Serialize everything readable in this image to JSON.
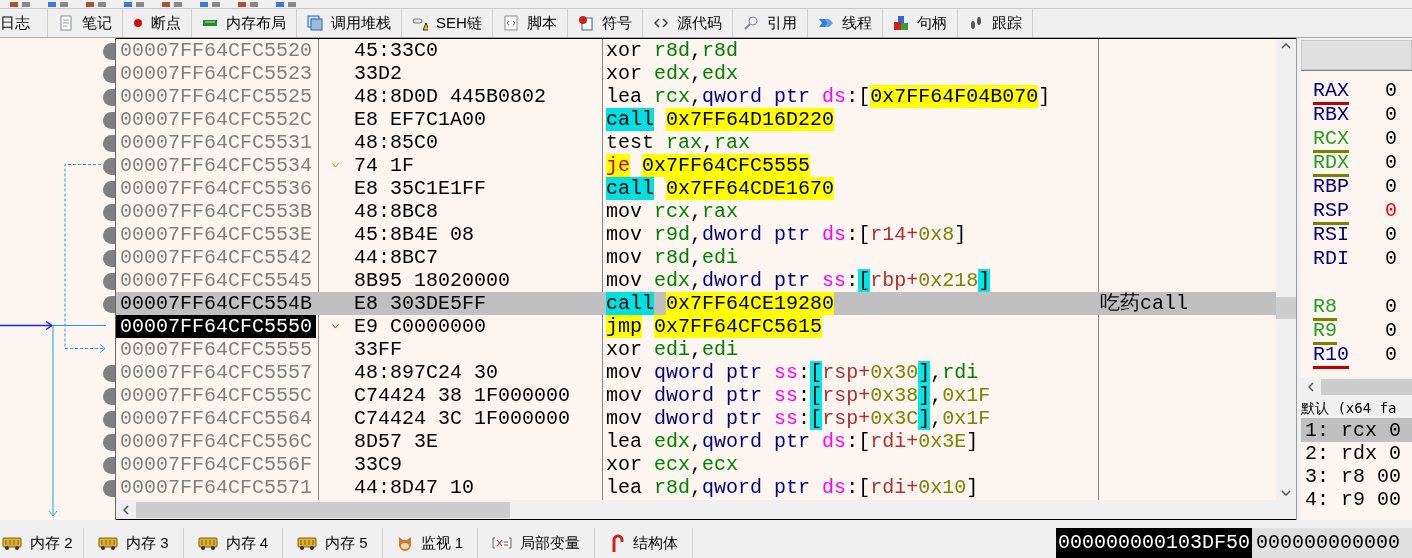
{
  "top_tabs": [
    {
      "label": "日志"
    },
    {
      "label": "笔记"
    },
    {
      "label": "断点"
    },
    {
      "label": "内存布局"
    },
    {
      "label": "调用堆栈"
    },
    {
      "label": "SEH链"
    },
    {
      "label": "脚本"
    },
    {
      "label": "符号"
    },
    {
      "label": "源代码"
    },
    {
      "label": "引用"
    },
    {
      "label": "线程"
    },
    {
      "label": "句柄"
    },
    {
      "label": "跟踪"
    }
  ],
  "disassembly": {
    "rows": [
      {
        "address": "00007FF64CFC5520",
        "bytes": "45:33C0",
        "dot": true,
        "selected": false,
        "current": false,
        "instruction": [
          {
            "t": "xor",
            "kind": "op"
          },
          {
            "t": "r8d",
            "kind": "reg"
          },
          {
            "t": ",",
            "kind": "p"
          },
          {
            "t": "r8d",
            "kind": "reg"
          }
        ]
      },
      {
        "address": "00007FF64CFC5523",
        "bytes": "33D2",
        "dot": true,
        "selected": false,
        "current": false,
        "instruction": [
          {
            "t": "xor",
            "kind": "op"
          },
          {
            "t": "edx",
            "kind": "reg"
          },
          {
            "t": ",",
            "kind": "p"
          },
          {
            "t": "edx",
            "kind": "reg"
          }
        ]
      },
      {
        "address": "00007FF64CFC5525",
        "bytes": "48:8D0D 445B0802",
        "dot": true,
        "selected": false,
        "current": false,
        "instruction": [
          {
            "t": "lea",
            "kind": "op"
          },
          {
            "t": "rcx",
            "kind": "reg"
          },
          {
            "t": ",",
            "kind": "p"
          },
          {
            "t": "qword ptr",
            "kind": "size"
          },
          {
            "t": "ds",
            "kind": "seg"
          },
          {
            "t": ":",
            "kind": "p"
          },
          {
            "t": "[",
            "kind": "p"
          },
          {
            "t": "0x7FF64F04B070",
            "kind": "addr"
          },
          {
            "t": "]",
            "kind": "p"
          }
        ]
      },
      {
        "address": "00007FF64CFC552C",
        "bytes": "E8 EF7C1A00",
        "dot": true,
        "selected": false,
        "current": false,
        "instruction": [
          {
            "t": "call",
            "kind": "call"
          },
          {
            "t": "0x7FF64D16D220",
            "kind": "addr"
          }
        ]
      },
      {
        "address": "00007FF64CFC5531",
        "bytes": "48:85C0",
        "dot": true,
        "selected": false,
        "current": false,
        "instruction": [
          {
            "t": "test",
            "kind": "op"
          },
          {
            "t": "rax",
            "kind": "reg"
          },
          {
            "t": ",",
            "kind": "p"
          },
          {
            "t": "rax",
            "kind": "reg"
          }
        ]
      },
      {
        "address": "00007FF64CFC5534",
        "bytes": "74 1F",
        "branch": {
          "taken": false
        },
        "dot": true,
        "selected": false,
        "current": false,
        "instruction": [
          {
            "t": "je",
            "kind": "jcc"
          },
          {
            "t": "0x7FF64CFC5555",
            "kind": "addr"
          }
        ]
      },
      {
        "address": "00007FF64CFC5536",
        "bytes": "E8 35C1E1FF",
        "dot": true,
        "selected": false,
        "current": false,
        "instruction": [
          {
            "t": "call",
            "kind": "call"
          },
          {
            "t": "0x7FF64CDE1670",
            "kind": "addr"
          }
        ]
      },
      {
        "address": "00007FF64CFC553B",
        "bytes": "48:8BC8",
        "dot": true,
        "selected": false,
        "current": false,
        "instruction": [
          {
            "t": "mov",
            "kind": "op"
          },
          {
            "t": "rcx",
            "kind": "reg"
          },
          {
            "t": ",",
            "kind": "p"
          },
          {
            "t": "rax",
            "kind": "reg"
          }
        ]
      },
      {
        "address": "00007FF64CFC553E",
        "bytes": "45:8B4E 08",
        "dot": true,
        "selected": false,
        "current": false,
        "instruction": [
          {
            "t": "mov",
            "kind": "op"
          },
          {
            "t": "r9d",
            "kind": "reg"
          },
          {
            "t": ",",
            "kind": "p"
          },
          {
            "t": "dword ptr",
            "kind": "size"
          },
          {
            "t": "ds",
            "kind": "seg"
          },
          {
            "t": ":",
            "kind": "p"
          },
          {
            "t": "[",
            "kind": "p"
          },
          {
            "t": "r14+",
            "kind": "mem"
          },
          {
            "t": "0x8",
            "kind": "num"
          },
          {
            "t": "]",
            "kind": "p"
          }
        ]
      },
      {
        "address": "00007FF64CFC5542",
        "bytes": "44:8BC7",
        "dot": true,
        "selected": false,
        "current": false,
        "instruction": [
          {
            "t": "mov",
            "kind": "op"
          },
          {
            "t": "r8d",
            "kind": "reg"
          },
          {
            "t": ",",
            "kind": "p"
          },
          {
            "t": "edi",
            "kind": "reg"
          }
        ]
      },
      {
        "address": "00007FF64CFC5545",
        "bytes": "8B95 18020000",
        "dot": true,
        "selected": false,
        "current": false,
        "instruction": [
          {
            "t": "mov",
            "kind": "op"
          },
          {
            "t": "edx",
            "kind": "reg"
          },
          {
            "t": ",",
            "kind": "p"
          },
          {
            "t": "dword ptr",
            "kind": "size"
          },
          {
            "t": "ss",
            "kind": "seg"
          },
          {
            "t": ":",
            "kind": "p"
          },
          {
            "t": "[",
            "kind": "hb"
          },
          {
            "t": "rbp+",
            "kind": "mem"
          },
          {
            "t": "0x218",
            "kind": "num"
          },
          {
            "t": "]",
            "kind": "hb"
          }
        ]
      },
      {
        "address": "00007FF64CFC554B",
        "bytes": "E8 303DE5FF",
        "dot": true,
        "selected": true,
        "current": false,
        "comment": "吃药call",
        "instruction": [
          {
            "t": "call",
            "kind": "call"
          },
          {
            "t": "0x7FF64CE19280",
            "kind": "addr"
          }
        ]
      },
      {
        "address": "00007FF64CFC5550",
        "bytes": "E9 C0000000",
        "branch": {
          "taken": true
        },
        "dot": false,
        "selected": false,
        "current": true,
        "instruction": [
          {
            "t": "jmp",
            "kind": "jmp"
          },
          {
            "t": "0x7FF64CFC5615",
            "kind": "addr"
          }
        ]
      },
      {
        "address": "00007FF64CFC5555",
        "bytes": "33FF",
        "dot": false,
        "selected": false,
        "current": false,
        "instruction": [
          {
            "t": "xor",
            "kind": "op"
          },
          {
            "t": "edi",
            "kind": "reg"
          },
          {
            "t": ",",
            "kind": "p"
          },
          {
            "t": "edi",
            "kind": "reg"
          }
        ]
      },
      {
        "address": "00007FF64CFC5557",
        "bytes": "48:897C24 30",
        "dot": true,
        "selected": false,
        "current": false,
        "instruction": [
          {
            "t": "mov",
            "kind": "op"
          },
          {
            "t": "qword ptr",
            "kind": "size"
          },
          {
            "t": "ss",
            "kind": "seg"
          },
          {
            "t": ":",
            "kind": "p"
          },
          {
            "t": "[",
            "kind": "hb"
          },
          {
            "t": "rsp+",
            "kind": "mem"
          },
          {
            "t": "0x30",
            "kind": "num"
          },
          {
            "t": "]",
            "kind": "hb"
          },
          {
            "t": ",",
            "kind": "p"
          },
          {
            "t": "rdi",
            "kind": "reg"
          }
        ]
      },
      {
        "address": "00007FF64CFC555C",
        "bytes": "C74424 38 1F000000",
        "dot": true,
        "selected": false,
        "current": false,
        "instruction": [
          {
            "t": "mov",
            "kind": "op"
          },
          {
            "t": "dword ptr",
            "kind": "size"
          },
          {
            "t": "ss",
            "kind": "seg"
          },
          {
            "t": ":",
            "kind": "p"
          },
          {
            "t": "[",
            "kind": "hb"
          },
          {
            "t": "rsp+",
            "kind": "mem"
          },
          {
            "t": "0x38",
            "kind": "num"
          },
          {
            "t": "]",
            "kind": "hb"
          },
          {
            "t": ",",
            "kind": "p"
          },
          {
            "t": "0x1F",
            "kind": "num"
          }
        ]
      },
      {
        "address": "00007FF64CFC5564",
        "bytes": "C74424 3C 1F000000",
        "dot": true,
        "selected": false,
        "current": false,
        "instruction": [
          {
            "t": "mov",
            "kind": "op"
          },
          {
            "t": "dword ptr",
            "kind": "size"
          },
          {
            "t": "ss",
            "kind": "seg"
          },
          {
            "t": ":",
            "kind": "p"
          },
          {
            "t": "[",
            "kind": "hb"
          },
          {
            "t": "rsp+",
            "kind": "mem"
          },
          {
            "t": "0x3C",
            "kind": "num"
          },
          {
            "t": "]",
            "kind": "hb"
          },
          {
            "t": ",",
            "kind": "p"
          },
          {
            "t": "0x1F",
            "kind": "num"
          }
        ]
      },
      {
        "address": "00007FF64CFC556C",
        "bytes": "8D57 3E",
        "dot": true,
        "selected": false,
        "current": false,
        "instruction": [
          {
            "t": "lea",
            "kind": "op"
          },
          {
            "t": "edx",
            "kind": "reg"
          },
          {
            "t": ",",
            "kind": "p"
          },
          {
            "t": "qword ptr",
            "kind": "size"
          },
          {
            "t": "ds",
            "kind": "seg"
          },
          {
            "t": ":",
            "kind": "p"
          },
          {
            "t": "[",
            "kind": "p"
          },
          {
            "t": "rdi+",
            "kind": "mem"
          },
          {
            "t": "0x3E",
            "kind": "num"
          },
          {
            "t": "]",
            "kind": "p"
          }
        ]
      },
      {
        "address": "00007FF64CFC556F",
        "bytes": "33C9",
        "dot": true,
        "selected": false,
        "current": false,
        "instruction": [
          {
            "t": "xor",
            "kind": "op"
          },
          {
            "t": "ecx",
            "kind": "reg"
          },
          {
            "t": ",",
            "kind": "p"
          },
          {
            "t": "ecx",
            "kind": "reg"
          }
        ]
      },
      {
        "address": "00007FF64CFC5571",
        "bytes": "44:8D47 10",
        "dot": true,
        "selected": false,
        "current": false,
        "instruction": [
          {
            "t": "lea",
            "kind": "op"
          },
          {
            "t": "r8d",
            "kind": "reg"
          },
          {
            "t": ",",
            "kind": "p"
          },
          {
            "t": "qword ptr",
            "kind": "size"
          },
          {
            "t": "ds",
            "kind": "seg"
          },
          {
            "t": ":",
            "kind": "p"
          },
          {
            "t": "[",
            "kind": "p"
          },
          {
            "t": "rdi+",
            "kind": "mem"
          },
          {
            "t": "0x10",
            "kind": "num"
          },
          {
            "t": "]",
            "kind": "p"
          }
        ]
      }
    ]
  },
  "registers": {
    "general": [
      {
        "name": "RAX",
        "value": "0",
        "color": "#c00000",
        "highlighted": false,
        "changed": false
      },
      {
        "name": "RBX",
        "value": "0",
        "highlighted": false,
        "changed": false
      },
      {
        "name": "RCX",
        "value": "0",
        "color": "#808000",
        "highlighted": true,
        "changed": false
      },
      {
        "name": "RDX",
        "value": "0",
        "color": "#808000",
        "highlighted": true,
        "changed": false
      },
      {
        "name": "RBP",
        "value": "0",
        "highlighted": false,
        "changed": false
      },
      {
        "name": "RSP",
        "value": "0",
        "color": "#808000",
        "highlighted": false,
        "changed": true
      },
      {
        "name": "RSI",
        "value": "0",
        "highlighted": false,
        "changed": false
      },
      {
        "name": "RDI",
        "value": "0",
        "highlighted": false,
        "changed": false
      }
    ],
    "extended": [
      {
        "name": "R8",
        "value": "0",
        "color": "#808000",
        "highlighted": true,
        "changed": false
      },
      {
        "name": "R9",
        "value": "0",
        "color": "#808000",
        "highlighted": true,
        "changed": false
      },
      {
        "name": "R10",
        "value": "0",
        "color": "#c00000",
        "highlighted": false,
        "changed": false
      }
    ]
  },
  "call_convention": {
    "title": "默认 (x64 fa",
    "args": [
      {
        "text": "1: rcx 0",
        "selected": true
      },
      {
        "text": "2: rdx 0",
        "selected": false
      },
      {
        "text": "3: r8 00",
        "selected": false
      },
      {
        "text": "4: r9 00",
        "selected": false
      }
    ]
  },
  "bottom_tabs": [
    {
      "label": "内存 2",
      "kind": "memory"
    },
    {
      "label": "内存 3",
      "kind": "memory"
    },
    {
      "label": "内存 4",
      "kind": "memory"
    },
    {
      "label": "内存 5",
      "kind": "memory"
    },
    {
      "label": "监视 1",
      "kind": "watch"
    },
    {
      "label": "局部变量",
      "kind": "locals"
    },
    {
      "label": "结构体",
      "kind": "struct"
    }
  ],
  "stack": {
    "address": "000000000103DF50",
    "value": "000000000000"
  }
}
